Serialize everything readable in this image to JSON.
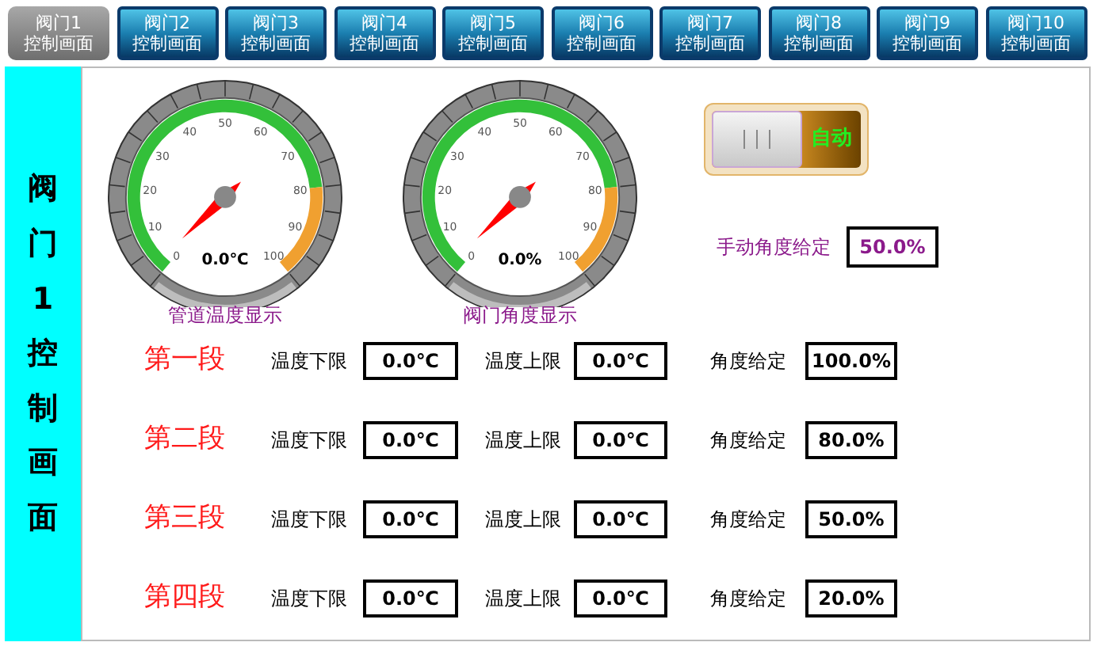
{
  "tabs": [
    {
      "title": "阀门1",
      "subtitle": "控制画面",
      "selected": true
    },
    {
      "title": "阀门2",
      "subtitle": "控制画面",
      "selected": false
    },
    {
      "title": "阀门3",
      "subtitle": "控制画面",
      "selected": false
    },
    {
      "title": "阀门4",
      "subtitle": "控制画面",
      "selected": false
    },
    {
      "title": "阀门5",
      "subtitle": "控制画面",
      "selected": false
    },
    {
      "title": "阀门6",
      "subtitle": "控制画面",
      "selected": false
    },
    {
      "title": "阀门7",
      "subtitle": "控制画面",
      "selected": false
    },
    {
      "title": "阀门8",
      "subtitle": "控制画面",
      "selected": false
    },
    {
      "title": "阀门9",
      "subtitle": "控制画面",
      "selected": false
    },
    {
      "title": "阀门10",
      "subtitle": "控制画面",
      "selected": false
    }
  ],
  "sidebar": {
    "title": "阀门1控制画面"
  },
  "gauges": [
    {
      "caption": "管道温度显示",
      "reading": "0.0℃",
      "scale": [
        "0",
        "10",
        "20",
        "30",
        "40",
        "50",
        "60",
        "70",
        "80",
        "90",
        "100"
      ]
    },
    {
      "caption": "阀门角度显示",
      "reading": "0.0%",
      "scale": [
        "0",
        "10",
        "20",
        "30",
        "40",
        "50",
        "60",
        "70",
        "80",
        "90",
        "100"
      ]
    }
  ],
  "mode_switch": {
    "label": "自动",
    "on": true
  },
  "manual_angle": {
    "label": "手动角度给定",
    "value": "50.0%"
  },
  "segments": [
    {
      "name": "第一段",
      "low_label": "温度下限",
      "low": "0.0℃",
      "high_label": "温度上限",
      "high": "0.0℃",
      "angle_label": "角度给定",
      "angle": "100.0%"
    },
    {
      "name": "第二段",
      "low_label": "温度下限",
      "low": "0.0℃",
      "high_label": "温度上限",
      "high": "0.0℃",
      "angle_label": "角度给定",
      "angle": "80.0%"
    },
    {
      "name": "第三段",
      "low_label": "温度下限",
      "low": "0.0℃",
      "high_label": "温度上限",
      "high": "0.0℃",
      "angle_label": "角度给定",
      "angle": "50.0%"
    },
    {
      "name": "第四段",
      "low_label": "温度下限",
      "low": "0.0℃",
      "high_label": "温度上限",
      "high": "0.0℃",
      "angle_label": "角度给定",
      "angle": "20.0%"
    }
  ]
}
